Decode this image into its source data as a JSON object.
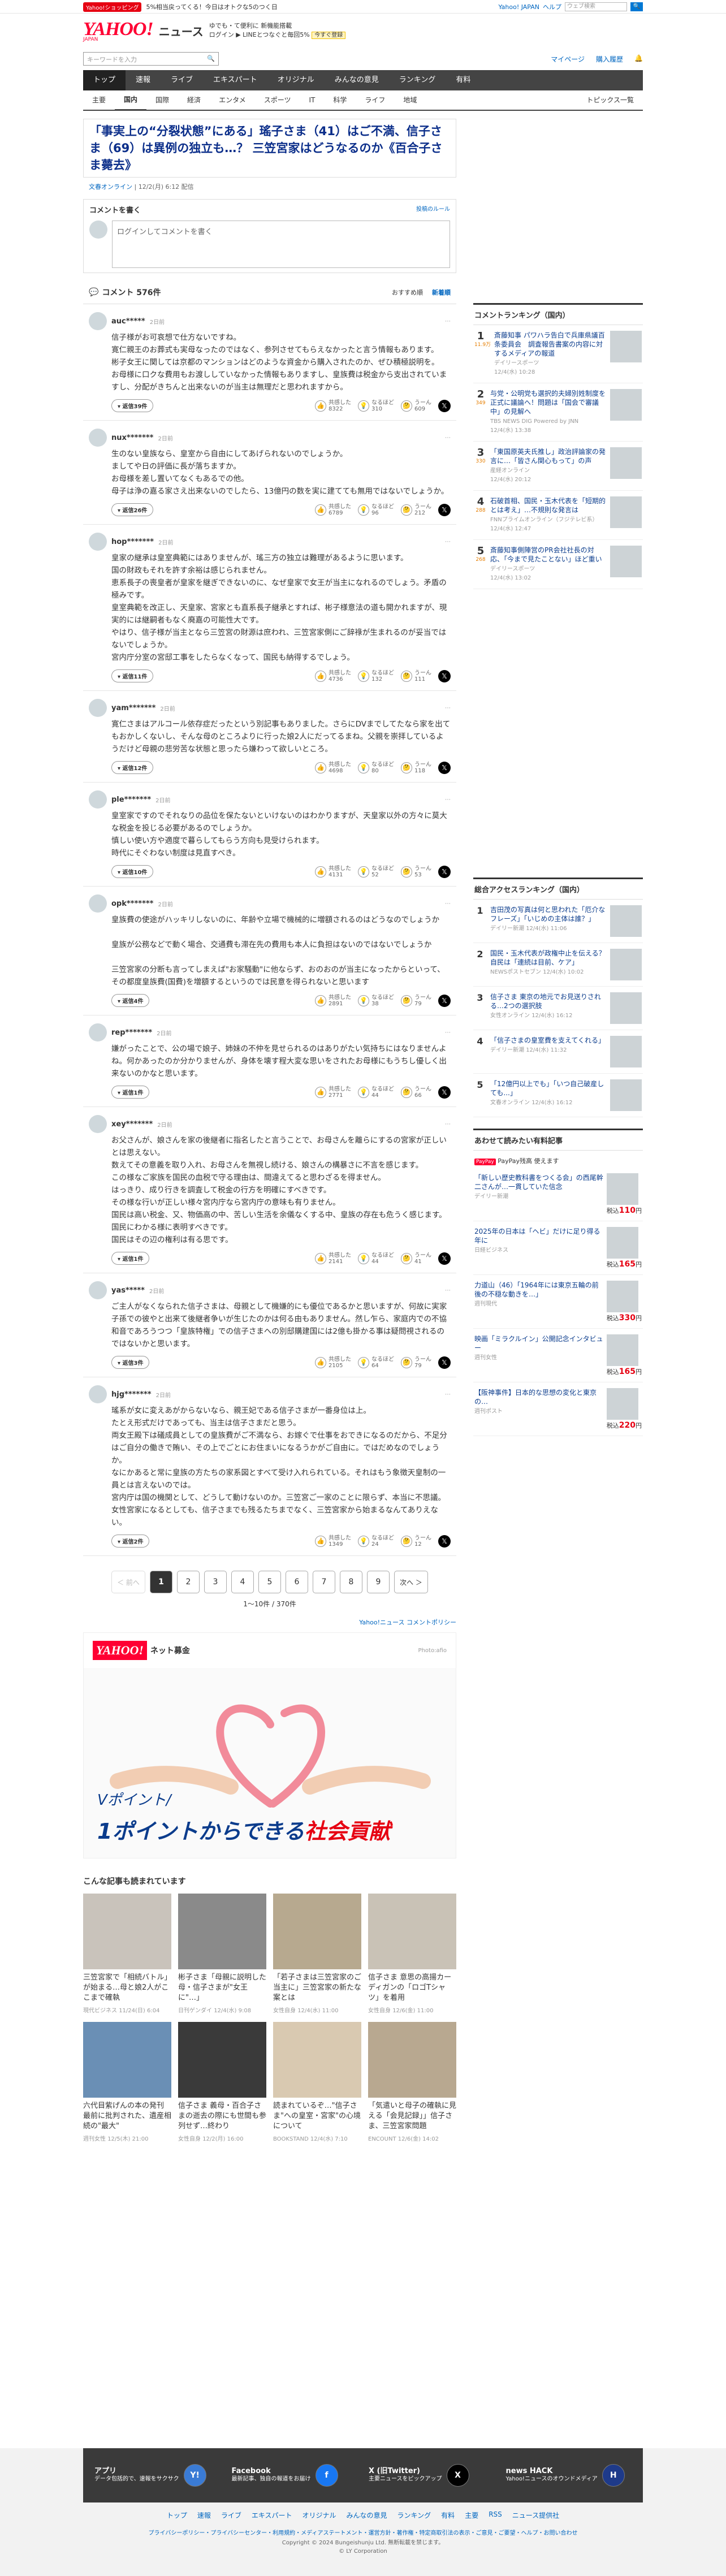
{
  "topbar": {
    "badge": "Yahoo!ショッピング",
    "promo_text": "5%相当戻ってくる！今日はオトクな5のつく日",
    "right_links": [
      "Yahoo! JAPAN",
      "ヘルプ"
    ],
    "search_placeholder": "ウェブ検索",
    "search_btn": "検索"
  },
  "header": {
    "logo": "YAHOO!",
    "logo_sub": "JAPAN",
    "service": "ニュース",
    "promo_line1": "ゆでも・て便利に 新機能搭載",
    "promo_line2": "ログイン ▶ LINEとつなぐと毎回5%",
    "promo_cta": "今すぐ登録"
  },
  "search": {
    "placeholder": "キーワードを入力",
    "icon": "search-icon",
    "links": [
      "マイページ",
      "購入履歴",
      "Bell"
    ]
  },
  "mainnav": [
    "トップ",
    "速報",
    "ライブ",
    "エキスパート",
    "オリジナル",
    "みんなの意見",
    "ランキング",
    "有料"
  ],
  "subnav": [
    "主要",
    "国内",
    "国際",
    "経済",
    "エンタメ",
    "スポーツ",
    "IT",
    "科学",
    "ライフ",
    "地域"
  ],
  "subnav_active": "国内",
  "subnav_topics": "トピックス一覧",
  "article": {
    "title": "「事実上の“分裂状態”にある」瑤子さま（41）はご不満、信子さま（69）は異例の独立も…？ 三笠宮家はどうなるのか《百合子さま薨去》",
    "source": "文春オンライン",
    "date": "12/2(月) 6:12 配信"
  },
  "comment_write": {
    "heading": "コメントを書く",
    "rules": "投稿のルール",
    "placeholder": "ログインしてコメントを書く"
  },
  "comment_count": "コメント 576件",
  "sort": {
    "recommend": "おすすめ順",
    "newest": "新着順"
  },
  "react_labels": {
    "agree": "共感した",
    "think": "なるほど",
    "hmm": "うーん"
  },
  "reply_prefix": "返信",
  "comments": [
    {
      "user": "auc*****",
      "time": "2日前",
      "body": "信子様がお可哀想で仕方ないですね。\n寛仁親王のお葬式も実母なったのではなく、参列させてもらえなかったと言う情報もあります。\n彬子女王に関しては京都のマンションはどのような資金から購入されたのか、ぜひ積極説明を。\nお母様に口クな費用もお渡ししていなかった情報もありますし、皇族費は税金から支出されていますし、分配がきちんと出来ないのが当主は無理だと思われますから。",
      "replies": "返信39件",
      "agree": "8322",
      "think": "310",
      "hmm": "609"
    },
    {
      "user": "nux*******",
      "time": "2日前",
      "body": "生のない皇族なら、皇室から自由にしてあげられないのでしょうか。\nましてや日の評価に長が落ちますか。\nお母様を差し置いてなくもあるでの他。\n母子は浄の嘉る家さえ出来ないのでしたら、13億円の数を実に建てても無用ではないでしょうか。",
      "replies": "返信26件",
      "agree": "6789",
      "think": "96",
      "hmm": "212"
    },
    {
      "user": "hop*******",
      "time": "2日前",
      "body": "皇家の継承は皇室典範にはありませんが、瑤三方の独立は難理があるように思います。\n国の財政もそれを許す余裕は感じられません。\n恵系長子の喪皇者が皇家を継ぎできないのに、なぜ皇家で女王が当主になれるのでしょう。矛盾の極みです。\n皇室典範を改正し、天皇家、宮家とも直系長子継承とすれば、彬子様意法の道も開かれますが、現実的には継嗣者もなく廃嘉の可能性大です。\nやはり、信子様が当主となら三笠宮の財源は庶われ、三笠宮家側にご辞祿が生まれるのが妥当ではないでしょうか。\n宮内庁分室の宮邸工事をしたらなくなって、国民も納得するでしょう。",
      "replies": "返信11件",
      "agree": "4736",
      "think": "132",
      "hmm": "111"
    },
    {
      "user": "yam*******",
      "time": "2日前",
      "body": "寛仁さまはアルコール依存症だったという別記事もありました。さらにDVまでしてたなら家を出てもおかしくないし、そんな母のところよりに行った娘2人にだってるまね。父親を崇拝しているようだけど母親の悲労苦な状態と思ったら嫌わって欲しいところ。",
      "replies": "返信12件",
      "agree": "4698",
      "think": "80",
      "hmm": "118"
    },
    {
      "user": "ple*******",
      "time": "2日前",
      "body": "皇室家ですのでそれなりの品位を保たないといけないのはわかりますが、天皇家以外の方々に莫大な税金を投じる必要があるのでしょうか。\n慎しい使い方や適度で暮らしてもらう方向も見受けられます。\n時代にそぐわない制度は見直すべき。",
      "replies": "返信10件",
      "agree": "4131",
      "think": "52",
      "hmm": "53"
    },
    {
      "user": "opk*******",
      "time": "2日前",
      "body": "皇族費の使途がハッキリしないのに、年齢や立場で機械的に増額されるのはどうなのでしょうか\n\n皇族が公務などで動く場合、交通費も滞在先の費用も本人に負担はないのではないでしょうか\n\n三笠宮家の分断も言ってしまえば\"お家騒動\"に他ならず、おのおのが当主になったからといって、その都度皇族費(国費)を増額するというのでは民意を得られないと思います",
      "replies": "返信4件",
      "agree": "2891",
      "think": "38",
      "hmm": "79"
    },
    {
      "user": "rep*******",
      "time": "2日前",
      "body": "嫌がったことで、公の場で娘子、姉妹の不仲を見せられるのはありがたい気持ちにはなりませんよね。何かあったのか分かりませんが、身体を壊す程大変な思いをされたお母様にもうちし優しく出来ないのかなと思います。",
      "replies": "返信1件",
      "agree": "2771",
      "think": "44",
      "hmm": "66"
    },
    {
      "user": "xey*******",
      "time": "2日前",
      "body": "お父さんが、娘さんを家の後継者に指名したと言うことで、お母さんを離らにするの宮家が正しいとは思えない。\n数えてその意義を取り入れ、お母さんを無視し続ける、娘さんの構暴さに不言を感じます。\nこの様なご家族を国民の血税で守る理由は、間違えてると思わざるを得ません。\nはっきり、成り行きを調査して税金の行方を明確にすべきです。\nその様な行いが正しい様々宮内庁なら宮内庁の意味も有りません。\n国民は高い税金、又、物価高の中、苦しい生活を余儀なくする中、皇族の存在も危うく感じます。\n国民にわかる様に表明すべきです。\n国民はその辺の権利は有る思です。",
      "replies": "返信1件",
      "agree": "2141",
      "think": "44",
      "hmm": "41"
    },
    {
      "user": "yas*****",
      "time": "2日前",
      "body": "ご主人がなくなられた信子さまは、母親として機嫌的にも優位であるかと思いますが、何故に実家子孫での彼やと出来て後継者争いが生じたのかは何る由もありません。然し乍ら、家庭内での不協和音であろうつつ「皇族特権」での信子さまへの別邸購建国には2億も掛かる事は疑問視されるのではないかと思います。",
      "replies": "返信3件",
      "agree": "2105",
      "think": "64",
      "hmm": "79"
    },
    {
      "user": "hjg*******",
      "time": "2日前",
      "body": "瑤系が女に変えあがからないなら、親王妃である信子さまが一番身位は上。\nたとえ形式だけであっても、当主は信子さまだと思う。\n両女王殿下は礒成員としての皇族費がご不満なら、お嫁ぐで仕事をおできになるのだから、不足分はご自分の働きで賄い、その上でごとにお住まいになるうかがご自由に。ではだめなのでしょうか。\nなにかあると常に皇族の方たちの家系図とすべて受け入れられている。それはもう象徴天皇制の一員とは言えないのでは。\n宮内庁は国の機関として、どうして動けないのか。三笠宮ご一家のことに限らず、本当に不思議。\n女性宮家になるとしても、信子さまでも残るたちまでなく、三笠宮家から始まるなんてありえない。",
      "replies": "返信2件",
      "agree": "1349",
      "think": "24",
      "hmm": "12"
    }
  ],
  "pager": {
    "prev": "＜ 前へ",
    "pages": [
      "1",
      "2",
      "3",
      "4",
      "5",
      "6",
      "7",
      "8",
      "9"
    ],
    "next": "次へ ＞",
    "info": "1〜10件 / 370件"
  },
  "policy_link": "Yahoo!ニュース コメントポリシー",
  "ad": {
    "logo": "YAHOO!",
    "kind": "ネット募金",
    "ptag": "Photo:afio",
    "line1": "Vポイント/",
    "line2_a": "1ポイントからできる",
    "line2_b": "社会貢献"
  },
  "more": {
    "heading": "こんな記事も読まれています",
    "cards": [
      {
        "title": "三笠宮家で「相続バトル」が始まる…母と娘2人がここまで確執",
        "src": "現代ビジネス",
        "date": "11/24(日) 6:04"
      },
      {
        "title": "彬子さま「母親に説明した母・信子さまが\"女王に\"…」",
        "src": "日刊ゲンダイ",
        "date": "12/4(水) 9:08"
      },
      {
        "title": "「若子さまは三笠宮家のご当主に」三笠宮家の新たな案とは",
        "src": "女性自身",
        "date": "12/4(水) 11:00"
      },
      {
        "title": "信子さま 意思の高揚カーディガンの「ロゴTシャツ」を着用",
        "src": "女性自身",
        "date": "12/6(金) 11:00"
      },
      {
        "title": "六代目紫げんの本の発刊 最前に批判された、遺産相続の\"最大\"",
        "src": "週刊女性",
        "date": "12/5(木) 21:00"
      },
      {
        "title": "信子さま 義母・百合子さまの逝去の際にも世間も参列せず…終わり",
        "src": "女性自身",
        "date": "12/2(月) 16:00"
      },
      {
        "title": "読まれているぞ…\"信子さま\"への皇室・宮家\"の心境について",
        "src": "BOOKSTAND",
        "date": "12/4(水) 7:10"
      },
      {
        "title": "「気遣いと母子の確執に見える「会見記録」」信子さま、三笠宮家問題",
        "src": "ENCOUNT",
        "date": "12/6(金) 14:02"
      }
    ]
  },
  "ranking": {
    "heading": "コメントランキング（国内）",
    "items": [
      {
        "num": "1",
        "count": "11.9万",
        "txt": "斎藤知事 パワハラ告白で兵庫県議百条委員会　調査報告書案の内容に対するメディアの報道",
        "src": "デイリースポーツ",
        "date": "12/4(水) 10:28"
      },
      {
        "num": "2",
        "count": "349",
        "txt": "与党・公明党も選択的夫婦別姓制度を正式に議論へ！問題は「国会で審議中」の見解へ",
        "src": "TBS NEWS DIG Powered by JNN",
        "date": "12/4(水) 13:38"
      },
      {
        "num": "3",
        "count": "330",
        "txt": "「東国原英夫氏推し」政治評論家の発言に…「皆さん関心もって」の声",
        "src": "産経オンライン",
        "date": "12/4(水) 20:12"
      },
      {
        "num": "4",
        "count": "288",
        "txt": "石破首相、国民・玉木代表を「短期的とは考え」…不規則な発言は",
        "src": "FNNプライムオンライン（フジテレビ系）",
        "date": "12/4(水) 12:47"
      },
      {
        "num": "5",
        "count": "268",
        "txt": "斎藤知事側陣営のPR会社社長の対応、「今まで見たことない」ほど重い",
        "src": "デイリースポーツ",
        "date": "12/4(水) 13:02"
      }
    ]
  },
  "access": {
    "heading": "総合アクセスランキング（国内）",
    "items": [
      {
        "num": "1",
        "txt": "吉田茂の写真は何と思われた「厄介なフレーズ」「いじめの主体は誰？」",
        "src": "デイリー新潮",
        "date": "12/4(水) 11:06"
      },
      {
        "num": "2",
        "txt": "国民・玉木代表が政権中止を伝える？自民は「連続は目前、ケア」",
        "src": "NEWSポストセブン",
        "date": "12/4(水) 10:02"
      },
      {
        "num": "3",
        "txt": "信子さま 東京の地元でお見送りされる…2つの選択肢",
        "src": "女性オンライン",
        "date": "12/4(水) 16:12"
      },
      {
        "num": "4",
        "txt": "「信子さまの皇室費を支えてくれる」",
        "src": "デイリー新潮",
        "date": "12/4(水) 11:32"
      },
      {
        "num": "5",
        "txt": "「12億円以上でも」「いつ自己破産しても...」",
        "src": "文春オンライン",
        "date": "12/4(水) 16:12"
      }
    ]
  },
  "shopping": {
    "heading": "あわせて読みたい有料記事",
    "pp": "PayPay",
    "pp_label": "PayPay残高 使えます",
    "items": [
      {
        "txt": "「新しい歴史教科書をつくる会」の西尾幹二さんが…一貫していた信念",
        "src": "デイリー新潮",
        "price": "110"
      },
      {
        "txt": "2025年の日本は「ヘビ」だけに足り得る年に",
        "src": "日経ビジネス",
        "price": "165"
      },
      {
        "txt": "力道山（46）「1964年には東京五輪の前後の不穏な動きを…」",
        "src": "週刊現代",
        "price": "330"
      },
      {
        "txt": "映画「ミラクルイン」公開記念インタビュー",
        "src": "週刊女性",
        "price": "165"
      },
      {
        "txt": "【阪神事件】日本的な思想の変化と東京の…",
        "src": "週刊ポスト",
        "price": "220"
      }
    ]
  },
  "price_suffix": "円",
  "price_prefix": "税込",
  "footer": {
    "cols": [
      {
        "title": "アプリ",
        "desc": "データ包括的で、速報をサクサク",
        "icon": "Y!"
      },
      {
        "title": "Facebook",
        "desc": "最新記事、独自の報道をお届け",
        "icon": "f"
      },
      {
        "title": "X (旧Twitter)",
        "desc": "主要ニュースをピックアップ",
        "icon": "X"
      },
      {
        "title": "news HACK",
        "desc": "Yahoo!ニュースのオウンドメディア",
        "icon": "H"
      }
    ],
    "nav": [
      "トップ",
      "速報",
      "ライブ",
      "エキスパート",
      "オリジナル",
      "みんなの意見",
      "ランキング",
      "有料",
      "主要",
      "RSS",
      "ニュース提供社"
    ],
    "links": "プライバシーポリシー・プライバシーセンター・利用規約・メディアステートメント・運営方針・著作権・特定商取引法の表示・ご意見・ご要望・ヘルプ・お問い合わせ",
    "copy1": "Copyright © 2024 Bungeishunju Ltd. 無断転載を禁じます。",
    "copy2": "© LY Corporation"
  }
}
